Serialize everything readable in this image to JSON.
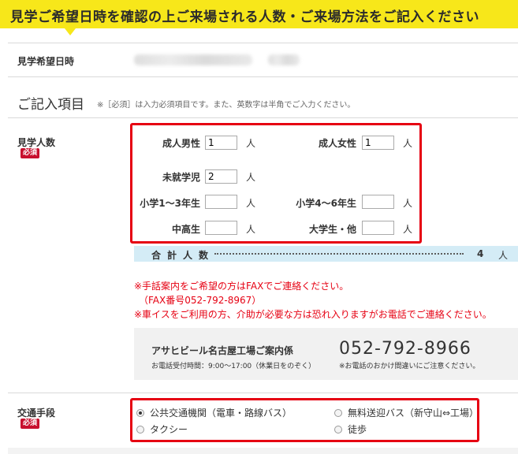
{
  "header": {
    "title": "見学ご希望日時を確認の上ご来場される人数・ご来場方法をご記入ください"
  },
  "visit_datetime": {
    "label": "見学希望日時"
  },
  "form_section": {
    "title": "ご記入項目",
    "note": "※［必須］は入力必須項目です。また、英数字は半角でご入力ください。",
    "required_badge": "必須"
  },
  "visitors": {
    "label": "見学人数",
    "unit": "人",
    "fields": [
      {
        "label": "成人男性",
        "value": "1"
      },
      {
        "label": "成人女性",
        "value": "1"
      },
      {
        "label": "未就学児",
        "value": "2"
      },
      {
        "label": "小学1～3年生",
        "value": ""
      },
      {
        "label": "小学4～6年生",
        "value": ""
      },
      {
        "label": "中高生",
        "value": ""
      },
      {
        "label": "大学生・他",
        "value": ""
      }
    ],
    "total_label": "合計人数",
    "total_value": "4",
    "total_unit": "人"
  },
  "notices": [
    "※手話案内をご希望の方はFAXでご連絡ください。",
    "（FAX番号052-792-8967）",
    "※車イスをご利用の方、介助が必要な方は恐れ入りますがお電話でご連絡ください。"
  ],
  "contact": {
    "name": "アサヒビール名古屋工場ご案内係",
    "hours": "お電話受付時間：9:00～17:00（休業日をのぞく）",
    "phone": "052-792-8966",
    "note": "※お電話のおかけ間違いにご注意ください。"
  },
  "transport": {
    "label": "交通手段",
    "selected": "公共交通機関（電車・路線バス）",
    "options": [
      {
        "label": "公共交通機関（電車・路線バス）",
        "checked": true
      },
      {
        "label": "無料送迎バス（新守山⇔工場）",
        "checked": false
      },
      {
        "label": "タクシー",
        "checked": false
      },
      {
        "label": "徒歩",
        "checked": false
      }
    ]
  },
  "colors": {
    "banner": "#f7e71a",
    "accent_red": "#e60012",
    "total_bar": "#d4ecf6"
  }
}
